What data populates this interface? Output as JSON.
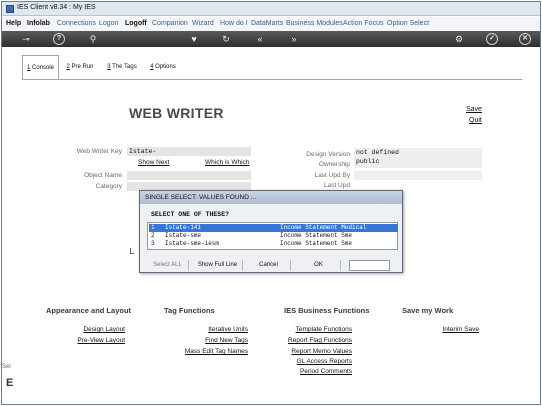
{
  "window": {
    "title": "IES Client v8.34 : My IES"
  },
  "menu": [
    {
      "label": "Help",
      "bold": true
    },
    {
      "label": "Infolab",
      "bold": true
    },
    {
      "label": "Connections",
      "bold": false
    },
    {
      "label": "Logon",
      "bold": false
    },
    {
      "label": "Logoff",
      "bold": true
    },
    {
      "label": "Companion",
      "bold": false
    },
    {
      "label": "Wizard",
      "bold": false
    },
    {
      "label": "How do I",
      "bold": false
    },
    {
      "label": "DataMarts",
      "bold": false
    },
    {
      "label": "Business Modules",
      "bold": false
    },
    {
      "label": "Action Focus",
      "bold": false
    },
    {
      "label": "Option Select",
      "bold": false
    }
  ],
  "toolbar": {
    "icons": [
      "key-icon",
      "help-icon",
      "search-icon",
      "heart-icon",
      "refresh-icon",
      "back-icon",
      "forward-icon",
      "settings-icon",
      "ok-icon",
      "close-icon"
    ],
    "glyphs": [
      "⊸",
      "?",
      "⚲",
      "♥",
      "↻",
      "«",
      "»",
      "⚙",
      "✓",
      "✕"
    ]
  },
  "tabs": [
    {
      "num": "1",
      "label": " Console"
    },
    {
      "num": "2",
      "label": " Pre Run"
    },
    {
      "num": "3",
      "label": " The Tags"
    },
    {
      "num": "4",
      "label": " Options"
    }
  ],
  "page": {
    "title": "WEB WRITER",
    "save": "Save",
    "quit": "Quit"
  },
  "form": {
    "key_label": "Web Writer Key",
    "key_value": "Istate-",
    "show_next": "Show Next",
    "which_is_which": "Which is Which",
    "object_name_label": "Object Name",
    "category_label": "Category",
    "design_version_label": "Design Version",
    "design_version_value": "not defined",
    "ownership_label": "Ownership",
    "ownership_value": "public",
    "last_upd_by_label": "Last Upd By",
    "last_upd_label": "Last Upd"
  },
  "dialog": {
    "title": "SINGLE SELECT: VALUES FOUND ...",
    "prompt": "SELECT ONE OF THESE?",
    "rows": [
      {
        "n": "1",
        "key": "Istate-141",
        "desc": "Income Statement Medical"
      },
      {
        "n": "2",
        "key": "Istate-sme",
        "desc": "Income Statement Sme"
      },
      {
        "n": "3",
        "key": "Istate-sme-iesm",
        "desc": "Income Statement Sme"
      }
    ],
    "buttons": {
      "select_all": "Select ALL",
      "show_full_line": "Show Full Line",
      "cancel": "Cancel",
      "ok": "OK"
    }
  },
  "sections": {
    "appearance": {
      "heading": "Appearance and Layout",
      "links": [
        "Design Layout",
        "Pre-View Layout"
      ]
    },
    "tags": {
      "heading": "Tag Functions",
      "links": [
        "Iterative Units",
        "Find New Tags",
        "Mass Edit Tag Names"
      ]
    },
    "ies": {
      "heading": "IES Business Functions",
      "links": [
        "Template Functions",
        "Report Flag Functions",
        "Report Memo Values",
        "GL Access Reports",
        "Period Comments"
      ]
    },
    "save": {
      "heading": "Save my Work",
      "links": [
        "Interim Save"
      ]
    }
  },
  "left_edge": {
    "small": "Sel",
    "big": "E"
  }
}
